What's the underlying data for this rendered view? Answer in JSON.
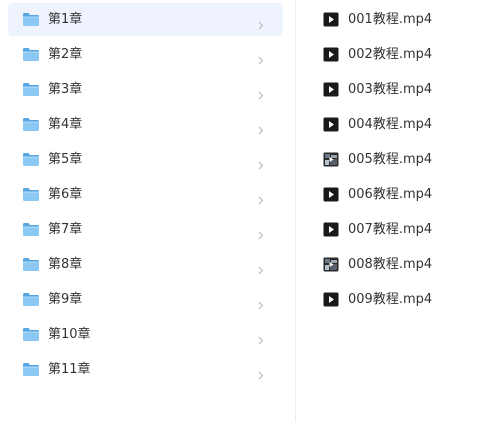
{
  "colors": {
    "selected_row": "#eef3fd",
    "folder_body": "#8cc8f4",
    "folder_back": "#5aa6e0",
    "video_icon": "#1a1a1a",
    "chevron": "#b8b8b8"
  },
  "folders": [
    {
      "label": "第1章",
      "selected": true
    },
    {
      "label": "第2章",
      "selected": false
    },
    {
      "label": "第3章",
      "selected": false
    },
    {
      "label": "第4章",
      "selected": false
    },
    {
      "label": "第5章",
      "selected": false
    },
    {
      "label": "第6章",
      "selected": false
    },
    {
      "label": "第7章",
      "selected": false
    },
    {
      "label": "第8章",
      "selected": false
    },
    {
      "label": "第9章",
      "selected": false
    },
    {
      "label": "第10章",
      "selected": false
    },
    {
      "label": "第11章",
      "selected": false
    }
  ],
  "files": [
    {
      "label": "001教程.mp4",
      "icon": "video-play-icon"
    },
    {
      "label": "002教程.mp4",
      "icon": "video-play-icon"
    },
    {
      "label": "003教程.mp4",
      "icon": "video-play-icon"
    },
    {
      "label": "004教程.mp4",
      "icon": "video-play-icon"
    },
    {
      "label": "005教程.mp4",
      "icon": "video-thumbnail-icon"
    },
    {
      "label": "006教程.mp4",
      "icon": "video-play-icon"
    },
    {
      "label": "007教程.mp4",
      "icon": "video-play-icon"
    },
    {
      "label": "008教程.mp4",
      "icon": "video-thumbnail-icon"
    },
    {
      "label": "009教程.mp4",
      "icon": "video-play-icon"
    }
  ]
}
